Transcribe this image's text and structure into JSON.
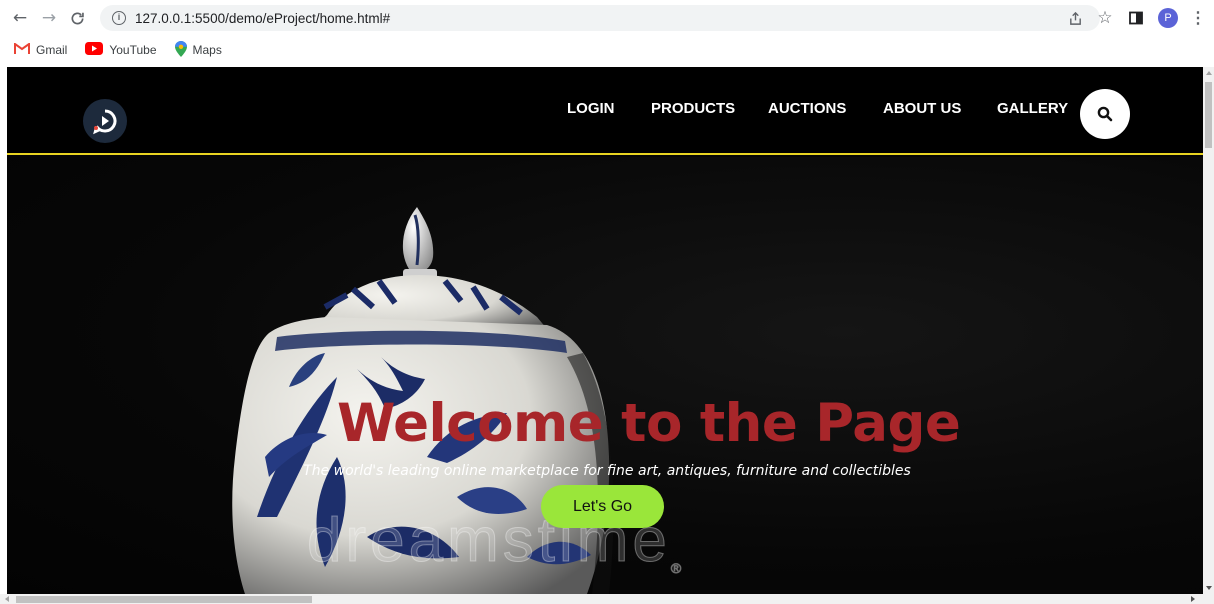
{
  "browser": {
    "url": "127.0.0.1:5500/demo/eProject/home.html#",
    "profile_initial": "P",
    "icons": [
      "back-icon",
      "forward-icon",
      "reload-icon",
      "info-icon",
      "share-icon",
      "star-icon",
      "side-panel-icon",
      "more-icon"
    ]
  },
  "bookmarks": [
    {
      "label": "Gmail",
      "icon": "gmail-icon"
    },
    {
      "label": "YouTube",
      "icon": "youtube-icon"
    },
    {
      "label": "Maps",
      "icon": "maps-icon"
    }
  ],
  "site": {
    "nav": [
      "LOGIN",
      "PRODUCTS",
      "AUCTIONS",
      "ABOUT US",
      "GALLERY"
    ],
    "hero": {
      "title": "Welcome to the Page",
      "subtitle": "The world's leading online marketplace for fine art, antiques, furniture and collectibles",
      "cta": "Let's Go",
      "watermark": "dreamstime"
    }
  },
  "colors": {
    "accent_line": "#e8d321",
    "hero_title": "#a8262a",
    "cta_bg": "#9ae63a",
    "profile_badge": "#5b63d7"
  }
}
